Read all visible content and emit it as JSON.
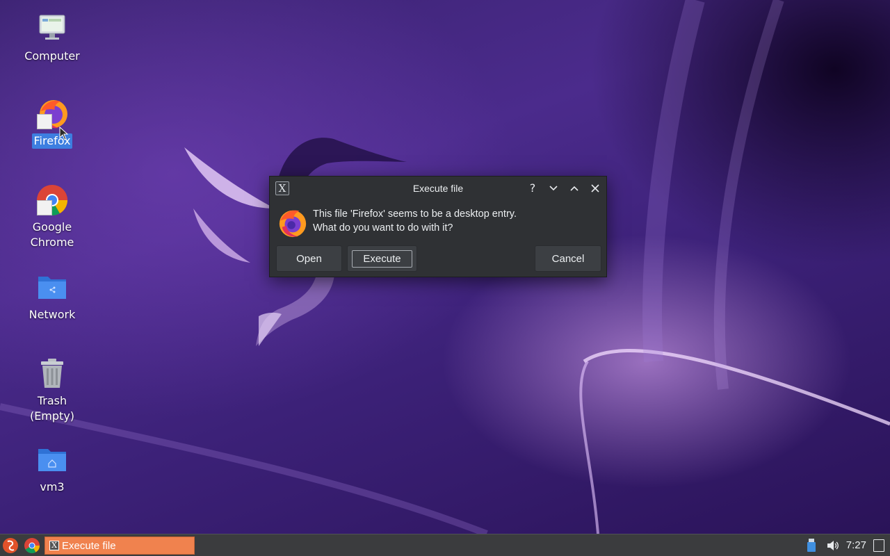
{
  "desktop_icons": [
    {
      "label": "Computer",
      "icon": "computer-icon"
    },
    {
      "label": "Firefox",
      "icon": "firefox-icon",
      "selected": true
    },
    {
      "label": "Google Chrome",
      "icon": "chrome-icon"
    },
    {
      "label": "Network",
      "icon": "network-folder-icon"
    },
    {
      "label": "Trash (Empty)",
      "icon": "trash-icon"
    },
    {
      "label": "vm3",
      "icon": "home-folder-icon"
    }
  ],
  "dialog": {
    "title": "Execute file",
    "message_line1": "This file 'Firefox' seems to be a desktop entry.",
    "message_line2": "What do you want to do with it?",
    "buttons": {
      "open": "Open",
      "execute": "Execute",
      "cancel": "Cancel"
    },
    "titlebar_buttons": [
      "help-icon",
      "minimize-icon",
      "maximize-icon",
      "close-icon"
    ],
    "help_glyph": "?"
  },
  "taskbar": {
    "task_label": "Execute file",
    "task_mini_glyph": "X",
    "clock": "7:27",
    "accent": "#f0824e"
  },
  "colors": {
    "selection": "#3d7ee0",
    "dialog_bg": "#2f3134"
  }
}
